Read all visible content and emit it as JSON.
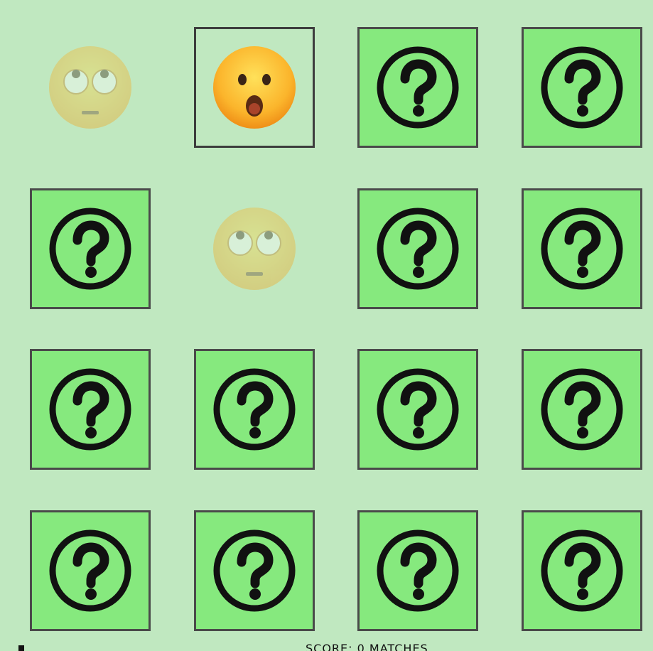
{
  "game": {
    "status_text": "SCORE: 0 MATCHES",
    "colors": {
      "background": "#c0e8c0",
      "card_back": "#86e97e",
      "card_border": "#4a4a4a"
    },
    "cards": [
      {
        "state": "matched",
        "face": "face-with-rolling-eyes"
      },
      {
        "state": "revealed",
        "face": "face-with-open-mouth"
      },
      {
        "state": "hidden",
        "face": "question-mark-icon"
      },
      {
        "state": "hidden",
        "face": "question-mark-icon"
      },
      {
        "state": "hidden",
        "face": "question-mark-icon"
      },
      {
        "state": "matched",
        "face": "face-with-rolling-eyes"
      },
      {
        "state": "hidden",
        "face": "question-mark-icon"
      },
      {
        "state": "hidden",
        "face": "question-mark-icon"
      },
      {
        "state": "hidden",
        "face": "question-mark-icon"
      },
      {
        "state": "hidden",
        "face": "question-mark-icon"
      },
      {
        "state": "hidden",
        "face": "question-mark-icon"
      },
      {
        "state": "hidden",
        "face": "question-mark-icon"
      },
      {
        "state": "hidden",
        "face": "question-mark-icon"
      },
      {
        "state": "hidden",
        "face": "question-mark-icon"
      },
      {
        "state": "hidden",
        "face": "question-mark-icon"
      },
      {
        "state": "hidden",
        "face": "question-mark-icon"
      }
    ]
  }
}
